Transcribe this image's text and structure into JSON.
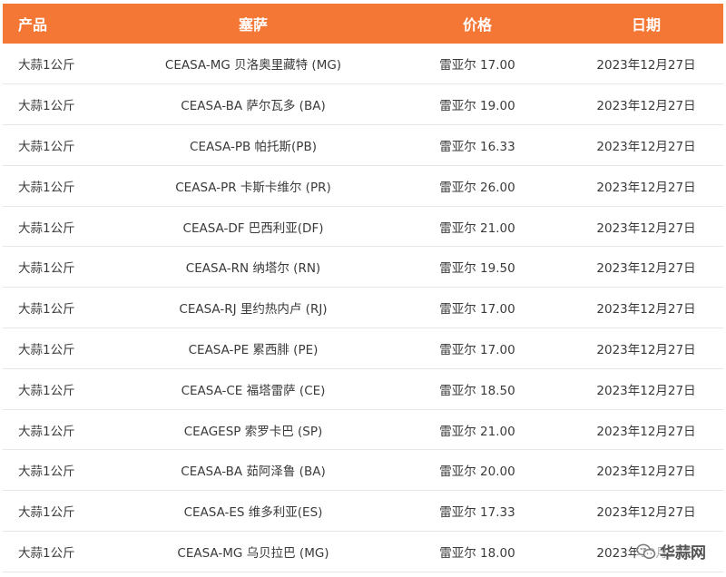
{
  "header": {
    "product": "产品",
    "market": "塞萨",
    "price": "价格",
    "date": "日期"
  },
  "rows": [
    {
      "product": "大蒜1公斤",
      "market": "CEASA-MG 贝洛奥里藏特 (MG)",
      "price": "雷亚尔 17.00",
      "date": "2023年12月27日"
    },
    {
      "product": "大蒜1公斤",
      "market": "CEASA-BA 萨尔瓦多 (BA)",
      "price": "雷亚尔 19.00",
      "date": "2023年12月27日"
    },
    {
      "product": "大蒜1公斤",
      "market": "CEASA-PB 帕托斯(PB)",
      "price": "雷亚尔 16.33",
      "date": "2023年12月27日"
    },
    {
      "product": "大蒜1公斤",
      "market": "CEASA-PR 卡斯卡维尔 (PR)",
      "price": "雷亚尔 26.00",
      "date": "2023年12月27日"
    },
    {
      "product": "大蒜1公斤",
      "market": "CEASA-DF 巴西利亚(DF)",
      "price": "雷亚尔 21.00",
      "date": "2023年12月27日"
    },
    {
      "product": "大蒜1公斤",
      "market": "CEASA-RN 纳塔尔 (RN)",
      "price": "雷亚尔 19.50",
      "date": "2023年12月27日"
    },
    {
      "product": "大蒜1公斤",
      "market": "CEASA-RJ 里约热内卢 (RJ)",
      "price": "雷亚尔 17.00",
      "date": "2023年12月27日"
    },
    {
      "product": "大蒜1公斤",
      "market": "CEASA-PE 累西腓 (PE)",
      "price": "雷亚尔 17.00",
      "date": "2023年12月27日"
    },
    {
      "product": "大蒜1公斤",
      "market": "CEASA-CE 福塔雷萨 (CE)",
      "price": "雷亚尔 18.50",
      "date": "2023年12月27日"
    },
    {
      "product": "大蒜1公斤",
      "market": "CEAGESP 索罗卡巴 (SP)",
      "price": "雷亚尔 21.00",
      "date": "2023年12月27日"
    },
    {
      "product": "大蒜1公斤",
      "market": "CEASA-BA 茹阿泽鲁 (BA)",
      "price": "雷亚尔 20.00",
      "date": "2023年12月27日"
    },
    {
      "product": "大蒜1公斤",
      "market": "CEASA-ES 维多利亚(ES)",
      "price": "雷亚尔 17.33",
      "date": "2023年12月27日"
    },
    {
      "product": "大蒜1公斤",
      "market": "CEASA-MG 乌贝拉巴 (MG)",
      "price": "雷亚尔 18.00",
      "date": "2023年12月27日"
    }
  ],
  "watermark": {
    "text": "华蒜网",
    "icon": "wechat-icon"
  },
  "colors": {
    "header_bg": "#f47735",
    "header_text": "#ffffff",
    "row_border": "#e8e8e8"
  }
}
